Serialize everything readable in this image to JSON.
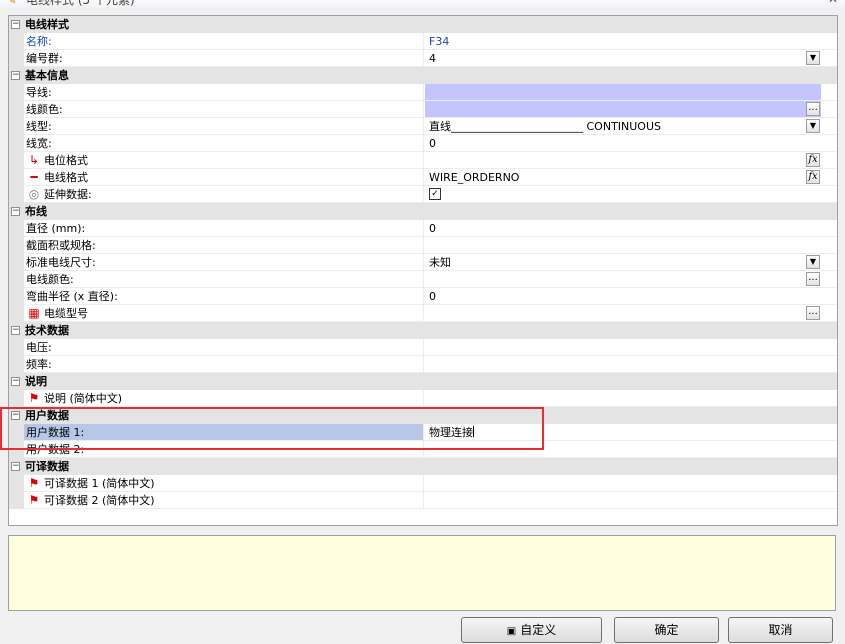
{
  "window": {
    "title": "电线样式 (5 个元素)",
    "icon": "pencil-icon"
  },
  "grid": [
    {
      "kind": "cat",
      "label": "电线样式"
    },
    {
      "kind": "prop",
      "name": "名称:",
      "value": "F34",
      "color": "blue"
    },
    {
      "kind": "prop",
      "name": "编号群:",
      "value": "4",
      "control": "dropdown"
    },
    {
      "kind": "cat",
      "label": "基本信息"
    },
    {
      "kind": "prop",
      "name": "导线:",
      "value": "",
      "highlight": true
    },
    {
      "kind": "prop",
      "name": "线颜色:",
      "value": "",
      "highlight": true,
      "control": "ellipsis"
    },
    {
      "kind": "prop",
      "name": "线型:",
      "value": "直线________________________ CONTINUOUS",
      "control": "dropdown"
    },
    {
      "kind": "prop",
      "name": "线宽:",
      "value": "0"
    },
    {
      "kind": "prop",
      "name": "电位格式",
      "value": "",
      "icon": "potential-format-icon",
      "control": "fx"
    },
    {
      "kind": "prop",
      "name": "电线格式",
      "value": "WIRE_ORDERNO",
      "icon": "wire-format-icon",
      "control": "fx"
    },
    {
      "kind": "prop",
      "name": "延伸数据:",
      "value": "",
      "icon": "extended-data-icon",
      "control": "checkbox",
      "checked": true
    },
    {
      "kind": "cat",
      "label": "布线"
    },
    {
      "kind": "prop",
      "name": "直径 (mm):",
      "value": "0"
    },
    {
      "kind": "prop",
      "name": "截面积或规格:",
      "value": ""
    },
    {
      "kind": "prop",
      "name": "标准电线尺寸:",
      "value": "未知",
      "control": "dropdown"
    },
    {
      "kind": "prop",
      "name": "电线颜色:",
      "value": "",
      "control": "ellipsis"
    },
    {
      "kind": "prop",
      "name": "弯曲半径 (x 直径):",
      "value": "0"
    },
    {
      "kind": "prop",
      "name": "电缆型号",
      "value": "",
      "icon": "cable-type-icon",
      "control": "ellipsis"
    },
    {
      "kind": "cat",
      "label": "技术数据"
    },
    {
      "kind": "prop",
      "name": "电压:",
      "value": ""
    },
    {
      "kind": "prop",
      "name": "频率:",
      "value": ""
    },
    {
      "kind": "cat",
      "label": "说明"
    },
    {
      "kind": "prop",
      "name": "说明 (简体中文)",
      "value": "",
      "icon": "flag-icon"
    },
    {
      "kind": "cat",
      "label": "用户数据"
    },
    {
      "kind": "prop",
      "name": "用户数据 1:",
      "value": "物理连接",
      "selected": true,
      "editing": true
    },
    {
      "kind": "prop",
      "name": "用户数据 2:",
      "value": ""
    },
    {
      "kind": "cat",
      "label": "可译数据"
    },
    {
      "kind": "prop",
      "name": "可译数据 1 (简体中文)",
      "value": "",
      "icon": "flag-icon"
    },
    {
      "kind": "prop",
      "name": "可译数据 2 (简体中文)",
      "value": "",
      "icon": "flag-icon"
    }
  ],
  "buttons": {
    "custom": "自定义",
    "custom_icon": "customize-icon",
    "ok": "确定",
    "cancel": "取消"
  }
}
